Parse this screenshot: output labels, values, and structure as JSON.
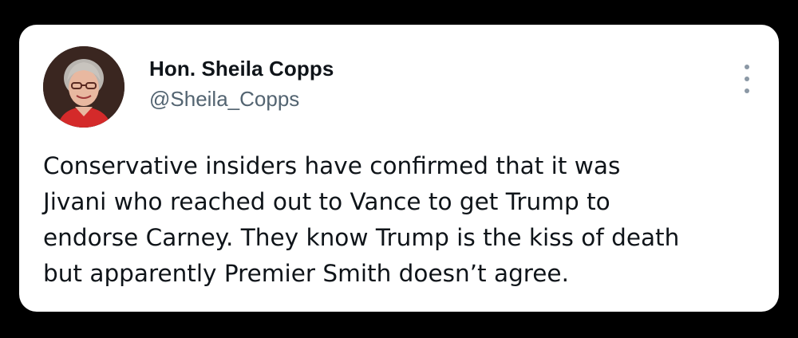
{
  "author": {
    "display_name": "Hon. Sheila Copps",
    "handle": "@Sheila_Copps"
  },
  "tweet": {
    "lines": [
      "Conservative insiders have confirmed that it was",
      "Jivani who reached out to Vance to get Trump to",
      "endorse Carney. They know Trump is the kiss of death",
      "but apparently Premier Smith doesn’t agree."
    ]
  },
  "icons": {
    "more": "more-vertical-icon"
  },
  "colors": {
    "background": "#000000",
    "card": "#ffffff",
    "text": "#0f1419",
    "secondary": "#536471",
    "icon": "#8b98a5"
  }
}
